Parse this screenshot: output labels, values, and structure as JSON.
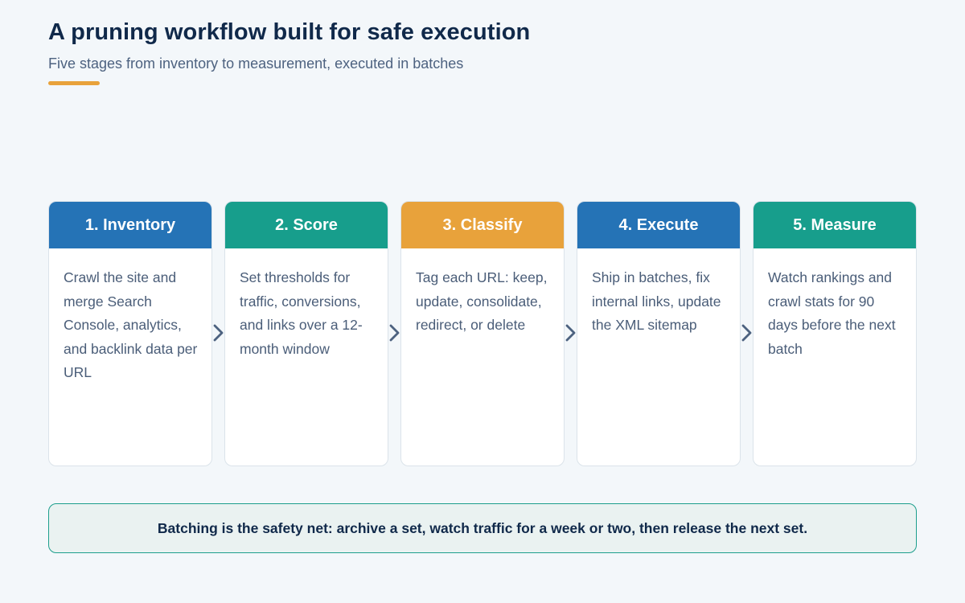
{
  "header": {
    "title": "A pruning workflow built for safe execution",
    "subtitle": "Five stages from inventory to measurement, executed in batches",
    "accent_color": "#e8a23b"
  },
  "stages": [
    {
      "label": "1. Inventory",
      "text": "Crawl the site and merge Search Console, analytics, and backlink data per URL",
      "color": "#2573b6"
    },
    {
      "label": "2. Score",
      "text": "Set thresholds for traffic, conversions, and links over a 12-month window",
      "color": "#179e8c"
    },
    {
      "label": "3. Classify",
      "text": "Tag each URL: keep, update, consolidate, redirect, or delete",
      "color": "#e8a23b"
    },
    {
      "label": "4. Execute",
      "text": "Ship in batches, fix internal links, update the XML sitemap",
      "color": "#2573b6"
    },
    {
      "label": "5. Measure",
      "text": "Watch rankings and crawl stats for 90 days before the next batch",
      "color": "#179e8c"
    }
  ],
  "arrows": [
    "chevron-right-icon",
    "chevron-right-icon",
    "chevron-right-icon",
    "chevron-right-icon"
  ],
  "footer_note": "Batching is the safety net: archive a set, watch traffic for a week or two, then release the next set."
}
